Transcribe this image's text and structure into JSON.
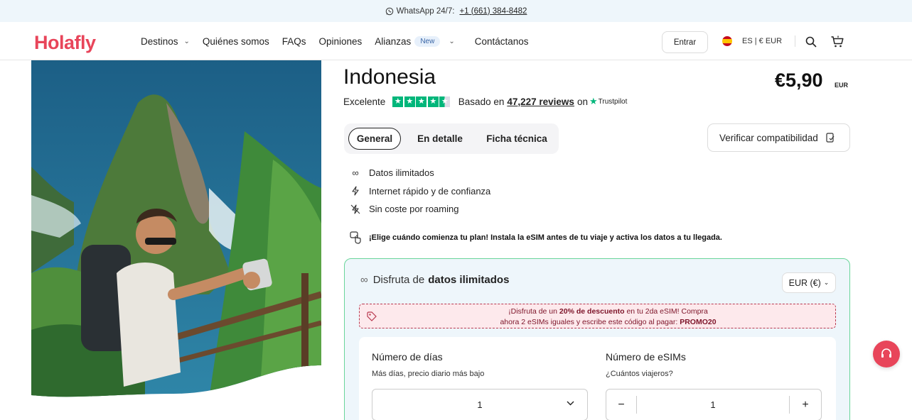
{
  "topbar": {
    "whatsapp_label": "WhatsApp 24/7:",
    "phone": "+1 (661) 384-8482"
  },
  "header": {
    "logo": "Holafly",
    "nav": [
      {
        "label": "Destinos",
        "has_dropdown": true
      },
      {
        "label": "Quiénes somos"
      },
      {
        "label": "FAQs"
      },
      {
        "label": "Opiniones"
      },
      {
        "label": "Alianzas",
        "badge": "New",
        "has_dropdown": true
      },
      {
        "label": "Contáctanos"
      }
    ],
    "login_button": "Entrar",
    "locale": "ES | € EUR",
    "icons": [
      "search-icon",
      "cart-icon"
    ]
  },
  "product": {
    "title": "Indonesia",
    "price": "€5,90",
    "price_currency": "EUR",
    "rating": {
      "label": "Excelente",
      "based_on": "Basado en",
      "reviews": "47,227 reviews",
      "on": "on",
      "provider": "Trustpilot",
      "stars": 4.5
    },
    "tabs": [
      "General",
      "En detalle",
      "Ficha técnica"
    ],
    "active_tab": "General",
    "verify_button": "Verificar compatibilidad",
    "features": [
      {
        "icon": "infinity-icon",
        "label": "Datos ilimitados"
      },
      {
        "icon": "lightning-icon",
        "label": "Internet rápido y de confianza"
      },
      {
        "icon": "no-roaming-icon",
        "label": "Sin coste por roaming"
      }
    ],
    "choose_notice": "¡Elige cuándo comienza tu plan! Instala la eSIM antes de tu viaje y activa los datos a tu llegada."
  },
  "plan": {
    "heading_prefix": "Disfruta de",
    "heading_bold": "datos ilimitados",
    "currency_select": "EUR (€)",
    "promo": {
      "line1_a": "¡Disfruta de un ",
      "line1_b": "20% de descuento",
      "line1_c": " en tu 2da eSIM! Compra",
      "line2_a": "ahora 2 eSIMs iguales y escribe este código al pagar: ",
      "line2_b": "PROMO20"
    },
    "days": {
      "title": "Número de días",
      "subtitle": "Más días, precio diario más bajo",
      "value": "1"
    },
    "esims": {
      "title": "Número de eSIMs",
      "subtitle": "¿Cuántos viajeros?",
      "value": "1",
      "minus": "−",
      "plus": "+"
    }
  },
  "colors": {
    "brand": "#e8455a",
    "trustpilot": "#00b67a",
    "plan_border": "#6ad59a",
    "promo_text": "#7d1429"
  }
}
